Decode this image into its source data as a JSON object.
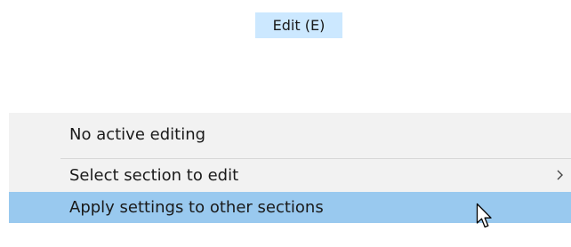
{
  "menu_bar": {
    "edit_label": "Edit (E)"
  },
  "dropdown": {
    "items": [
      {
        "label": "No active editing",
        "has_submenu": false,
        "highlighted": false
      },
      {
        "label": "Select section to edit",
        "has_submenu": true,
        "highlighted": false
      },
      {
        "label": "Apply settings to other sections",
        "has_submenu": false,
        "highlighted": true
      }
    ],
    "submenu_icon": "chevron-right-icon"
  },
  "cursor": {
    "icon": "mouse-pointer-icon"
  },
  "colors": {
    "header_highlight": "#cce8ff",
    "menu_background": "#f2f2f2",
    "item_highlight": "#99c9ef",
    "separator": "#d7d7d7"
  }
}
